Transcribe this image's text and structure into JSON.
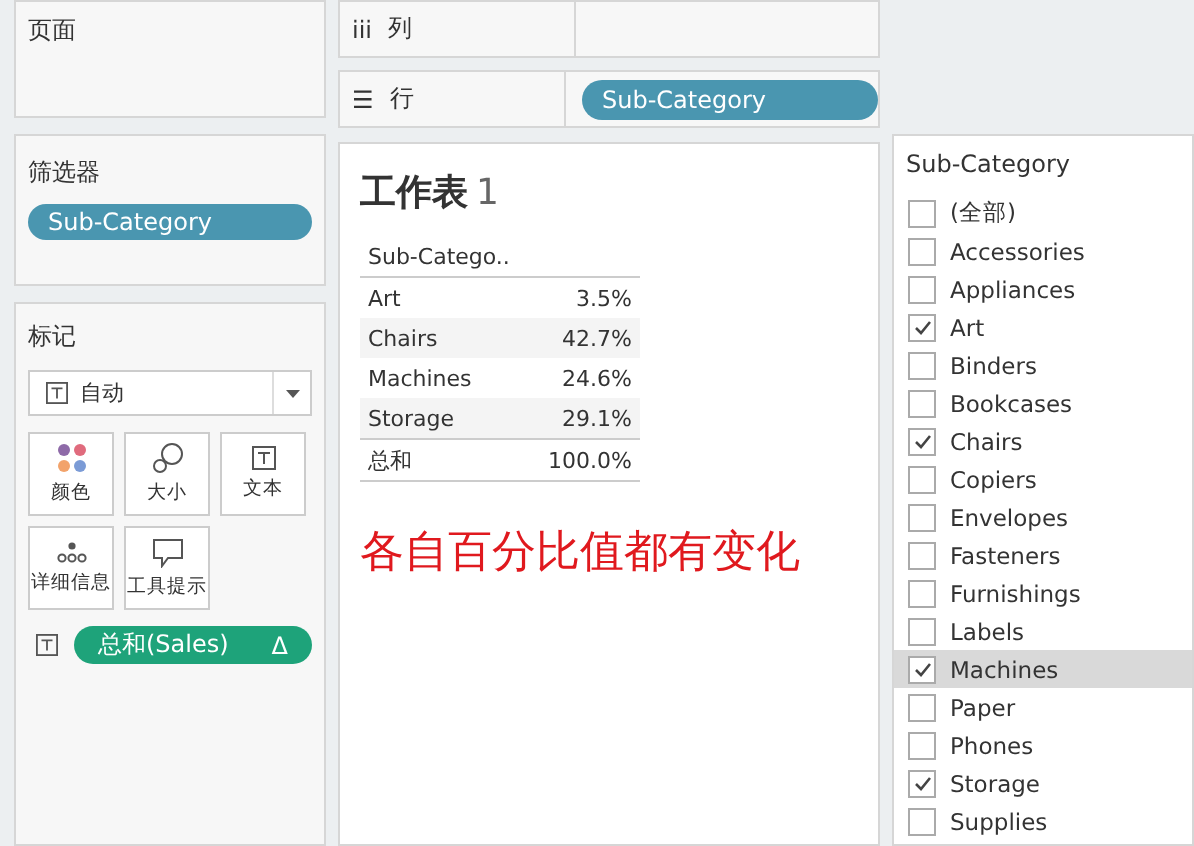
{
  "pages_card": {
    "title": "页面"
  },
  "filters_card": {
    "title": "筛选器",
    "pills": [
      "Sub-Category"
    ]
  },
  "marks_card": {
    "title": "标记",
    "mark_type": "自动",
    "buttons": [
      {
        "kind": "color",
        "label": "颜色"
      },
      {
        "kind": "size",
        "label": "大小"
      },
      {
        "kind": "text",
        "label": "文本"
      },
      {
        "kind": "detail",
        "label": "详细信息"
      },
      {
        "kind": "tooltip",
        "label": "工具提示"
      }
    ],
    "field": {
      "label": "总和(Sales)",
      "delta": "Δ"
    }
  },
  "columns_shelf": {
    "icon": "iii",
    "label": "列"
  },
  "rows_shelf": {
    "icon": "☰",
    "label": "行",
    "pills": [
      "Sub-Category"
    ]
  },
  "worksheet": {
    "title": "工作表",
    "number": "1",
    "header": "Sub-Catego..",
    "rows": [
      {
        "name": "Art",
        "value": "3.5%"
      },
      {
        "name": "Chairs",
        "value": "42.7%"
      },
      {
        "name": "Machines",
        "value": "24.6%"
      },
      {
        "name": "Storage",
        "value": "29.1%"
      }
    ],
    "total": {
      "name": "总和",
      "value": "100.0%"
    },
    "annotation": "各自百分比值都有变化"
  },
  "filter_list": {
    "title": "Sub-Category",
    "items": [
      {
        "label": "(全部)",
        "checked": false,
        "hovered": false
      },
      {
        "label": "Accessories",
        "checked": false,
        "hovered": false
      },
      {
        "label": "Appliances",
        "checked": false,
        "hovered": false
      },
      {
        "label": "Art",
        "checked": true,
        "hovered": false
      },
      {
        "label": "Binders",
        "checked": false,
        "hovered": false
      },
      {
        "label": "Bookcases",
        "checked": false,
        "hovered": false
      },
      {
        "label": "Chairs",
        "checked": true,
        "hovered": false
      },
      {
        "label": "Copiers",
        "checked": false,
        "hovered": false
      },
      {
        "label": "Envelopes",
        "checked": false,
        "hovered": false
      },
      {
        "label": "Fasteners",
        "checked": false,
        "hovered": false
      },
      {
        "label": "Furnishings",
        "checked": false,
        "hovered": false
      },
      {
        "label": "Labels",
        "checked": false,
        "hovered": false
      },
      {
        "label": "Machines",
        "checked": true,
        "hovered": true
      },
      {
        "label": "Paper",
        "checked": false,
        "hovered": false
      },
      {
        "label": "Phones",
        "checked": false,
        "hovered": false
      },
      {
        "label": "Storage",
        "checked": true,
        "hovered": false
      },
      {
        "label": "Supplies",
        "checked": false,
        "hovered": false
      }
    ]
  }
}
